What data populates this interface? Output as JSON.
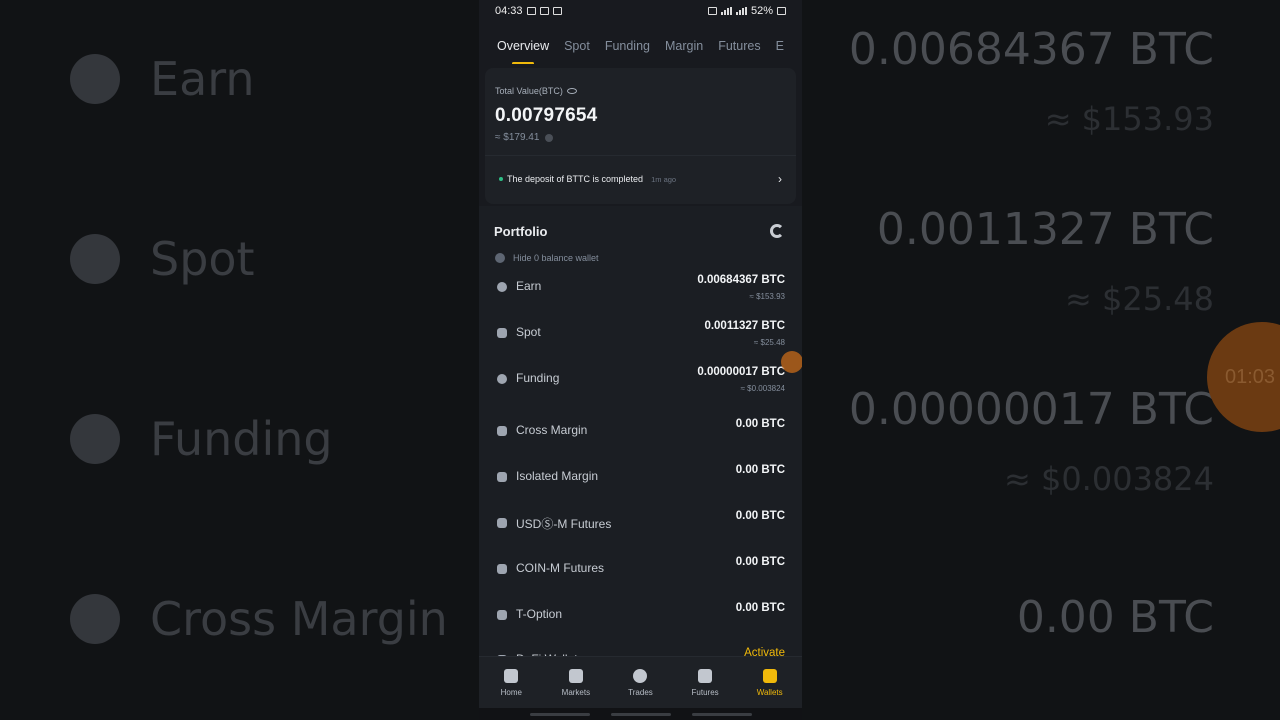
{
  "status": {
    "time": "04:33",
    "battery": "52%"
  },
  "tabs": [
    {
      "label": "Overview"
    },
    {
      "label": "Spot"
    },
    {
      "label": "Funding"
    },
    {
      "label": "Margin"
    },
    {
      "label": "Futures"
    },
    {
      "label": "E"
    }
  ],
  "overview": {
    "total_label": "Total Value(BTC)",
    "total_value": "0.00797654",
    "total_usd": "≈ $179.41",
    "notice_text": "The deposit of BTTC is completed",
    "notice_time": "1m ago"
  },
  "portfolio": {
    "title": "Portfolio",
    "hide_zero": "Hide 0 balance wallet",
    "rows": [
      {
        "name": "Earn",
        "value": "0.00684367 BTC",
        "usd": "≈ $153.93",
        "icon": "earn-icon"
      },
      {
        "name": "Spot",
        "value": "0.0011327 BTC",
        "usd": "≈ $25.48",
        "icon": "spot-icon"
      },
      {
        "name": "Funding",
        "value": "0.00000017 BTC",
        "usd": "≈ $0.003824",
        "icon": "funding-icon"
      },
      {
        "name": "Cross Margin",
        "value": "0.00 BTC",
        "usd": "",
        "icon": "cross-margin-icon"
      },
      {
        "name": "Isolated Margin",
        "value": "0.00 BTC",
        "usd": "",
        "icon": "isolated-margin-icon"
      },
      {
        "name": "USDⓈ-M Futures",
        "value": "0.00 BTC",
        "usd": "",
        "icon": "futures-icon"
      },
      {
        "name": "COIN-M Futures",
        "value": "0.00 BTC",
        "usd": "",
        "icon": "futures-icon"
      },
      {
        "name": "T-Option",
        "value": "0.00 BTC",
        "usd": "",
        "icon": "option-icon"
      },
      {
        "name": "DeFi Wallet",
        "value": "Activate",
        "usd": "",
        "icon": "defi-icon"
      }
    ]
  },
  "bottom_nav": [
    {
      "label": "Home",
      "icon": "home-icon"
    },
    {
      "label": "Markets",
      "icon": "markets-icon"
    },
    {
      "label": "Trades",
      "icon": "trades-icon"
    },
    {
      "label": "Futures",
      "icon": "futures-icon"
    },
    {
      "label": "Wallets",
      "icon": "wallet-icon"
    }
  ],
  "background": {
    "left_labels": [
      "Earn",
      "Spot",
      "Funding",
      "Cross Margin"
    ],
    "right_values": [
      "0.00684367 BTC",
      "≈ $153.93",
      "0.0011327 BTC",
      "≈ $25.48",
      "0.00000017 BTC",
      "≈ $0.003824",
      "0.00 BTC"
    ],
    "timer": "01:03"
  },
  "colors": {
    "accent": "#f0b90b",
    "positive": "#2ebd85",
    "bg": "#181a1f"
  }
}
